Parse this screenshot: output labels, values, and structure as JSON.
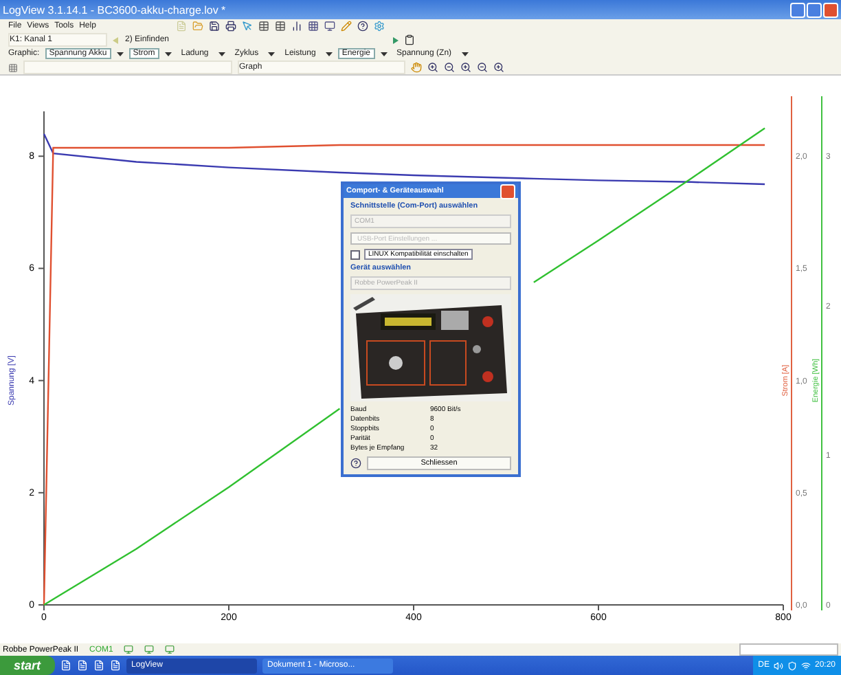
{
  "window": {
    "title": "LogView 3.1.14.1 - BC3600-akku-charge.lov *"
  },
  "menu": [
    "File",
    "Views",
    "Tools",
    "Help"
  ],
  "toolbar": {
    "channel": "K1: Kanal 1",
    "filter": "2) Einfinden"
  },
  "graph_bar": {
    "label": "Graphic:",
    "items": [
      {
        "label": "Spannung Akku",
        "selected": true
      },
      {
        "label": "Strom",
        "selected": true
      },
      {
        "label": "Ladung",
        "selected": false
      },
      {
        "label": "Zyklus",
        "selected": false
      },
      {
        "label": "Leistung",
        "selected": false
      },
      {
        "label": "Energie",
        "selected": true
      },
      {
        "label": "Spannung (Zn)",
        "selected": false
      }
    ]
  },
  "view_bar": {
    "mode": "Graph"
  },
  "chart": {
    "chart_data": {
      "type": "line",
      "ylabel": "Spannung [V]",
      "x": [
        0,
        10,
        100,
        200,
        320,
        400,
        530,
        600,
        700,
        780
      ],
      "xlim": [
        0,
        800
      ],
      "ylim": [
        0,
        8.8
      ],
      "xticks": [
        0,
        200,
        400,
        600,
        800
      ],
      "yticks": [
        0,
        2,
        4,
        6,
        8
      ],
      "series": [
        {
          "color": "#3a3ab0",
          "values": [
            8.4,
            8.05,
            7.9,
            7.8,
            7.71,
            7.66,
            7.6,
            7.57,
            7.54,
            7.5
          ]
        },
        {
          "color": "#e05030",
          "values": [
            0,
            8.15,
            8.15,
            8.15,
            8.2,
            8.2,
            8.2,
            8.2,
            8.2,
            8.2
          ]
        },
        {
          "color": "#30c030",
          "values": [
            0,
            0.1,
            1.0,
            2.1,
            3.5,
            null,
            5.75,
            6.5,
            7.6,
            8.5
          ]
        }
      ]
    },
    "right_axes": [
      {
        "label": "Strom [A]",
        "color": "#e06040",
        "ticks": [
          "2,0",
          "1,5",
          "1,0",
          "0,5",
          "0,0"
        ]
      },
      {
        "label": "Energie [Wh]",
        "color": "#40c040",
        "ticks": [
          "3",
          "2",
          "1",
          "0"
        ]
      }
    ]
  },
  "dialog": {
    "title": "Comport- & Geräteauswahl",
    "port_heading": "Schnittstelle (Com-Port) auswählen",
    "port": {
      "value": "COM1",
      "disabled": true
    },
    "usb_button": {
      "label": "USB-Port Einstellungen ...",
      "disabled": true
    },
    "linux": {
      "label": "LINUX Kompatibilität einschalten",
      "checked": false
    },
    "device_heading": "Gerät auswählen",
    "device": {
      "value": "Robbe PowerPeak II",
      "disabled": true
    },
    "info": [
      {
        "key": "Baud",
        "value": "9600 Bit/s"
      },
      {
        "key": "Datenbits",
        "value": "8"
      },
      {
        "key": "Stoppbits",
        "value": "0"
      },
      {
        "key": "Parität",
        "value": "0"
      },
      {
        "key": "Bytes je Empfang",
        "value": "32"
      }
    ],
    "close": "Schliessen"
  },
  "status_bar": {
    "device": "Robbe PowerPeak II",
    "port": "COM1"
  },
  "taskbar": {
    "start": "start",
    "tasks": [
      {
        "label": "LogView",
        "selected": true
      },
      {
        "label": "Dokument 1 - Microso...",
        "selected": false
      }
    ],
    "language": "DE",
    "time": "20:20"
  }
}
